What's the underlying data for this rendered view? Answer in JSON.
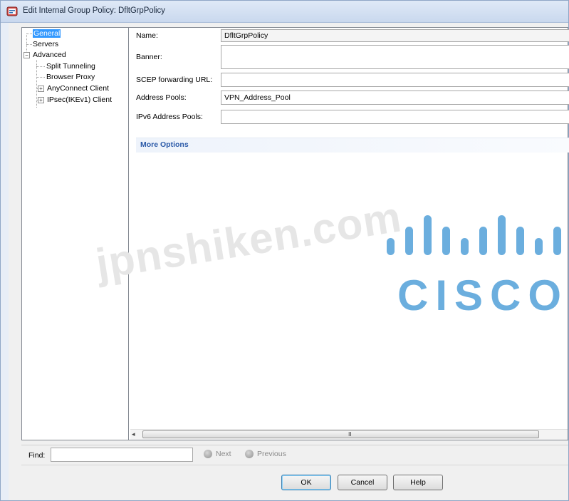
{
  "window": {
    "title": "Edit Internal Group Policy: DfltGrpPolicy"
  },
  "tree": {
    "items": [
      {
        "label": "General",
        "selected": true
      },
      {
        "label": "Servers"
      },
      {
        "label": "Advanced",
        "expander": "⊟"
      },
      {
        "label": "Split Tunneling"
      },
      {
        "label": "Browser Proxy"
      },
      {
        "label": "AnyConnect Client",
        "expander": "⊞"
      },
      {
        "label": "IPsec(IKEv1) Client",
        "expander": "⊞"
      }
    ]
  },
  "form": {
    "name_label": "Name:",
    "name_value": "DfltGrpPolicy",
    "banner_label": "Banner:",
    "banner_value": "",
    "scep_label": "SCEP forwarding URL:",
    "scep_value": "",
    "address_pools_label": "Address Pools:",
    "address_pools_value": "VPN_Address_Pool",
    "ipv6_pools_label": "IPv6 Address Pools:",
    "ipv6_pools_value": ""
  },
  "more_options": "More Options",
  "scrollbar": {
    "left_arrow": "◂",
    "grip": "III"
  },
  "find": {
    "label": "Find:",
    "value": "",
    "next_label": "Next",
    "previous_label": "Previous"
  },
  "buttons": {
    "ok": "OK",
    "cancel": "Cancel",
    "help": "Help"
  },
  "watermark": {
    "text": "jpnshiken.com",
    "brand": "CISCO"
  },
  "colors": {
    "selection": "#3399ff",
    "more_options_text": "#2b5aa8",
    "cisco_blue": "#6baede"
  }
}
